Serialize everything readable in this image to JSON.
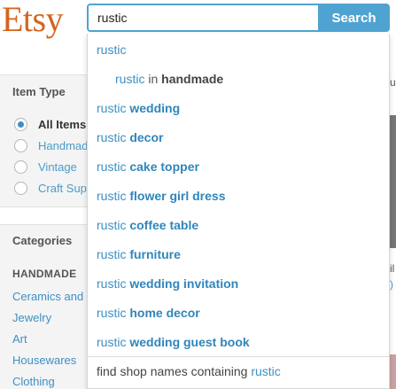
{
  "header": {
    "logo": "Etsy",
    "search_value": "rustic",
    "search_button": "Search"
  },
  "sidebar": {
    "item_type": {
      "title": "Item Type",
      "options": [
        "All Items",
        "Handmad",
        "Vintage",
        "Craft Sup"
      ],
      "selected": "All Items"
    },
    "categories": {
      "title": "Categories",
      "section": "HANDMADE",
      "links": [
        "Ceramics and",
        "Jewelry",
        "Art",
        "Housewares",
        "Clothing"
      ]
    }
  },
  "dropdown": {
    "query": "rustic",
    "top": "rustic",
    "sub": {
      "query": "rustic",
      "in": "in",
      "scope": "handmade"
    },
    "suggestions": [
      {
        "query": "rustic",
        "rest": "wedding"
      },
      {
        "query": "rustic",
        "rest": "decor"
      },
      {
        "query": "rustic",
        "rest": "cake topper"
      },
      {
        "query": "rustic",
        "rest": "flower girl dress"
      },
      {
        "query": "rustic",
        "rest": "coffee table"
      },
      {
        "query": "rustic",
        "rest": "furniture"
      },
      {
        "query": "rustic",
        "rest": "wedding invitation"
      },
      {
        "query": "rustic",
        "rest": "home decor"
      },
      {
        "query": "rustic",
        "rest": "wedding guest book"
      }
    ],
    "shop_prefix": "find shop names containing",
    "shop_query": "rustic"
  },
  "edge": {
    "top_letter": "u",
    "mid_letter": "il",
    "low_letter": ")"
  },
  "colors": {
    "brand": "#d5641c",
    "accent": "#4fa3d1",
    "link": "#3e8fc4"
  }
}
